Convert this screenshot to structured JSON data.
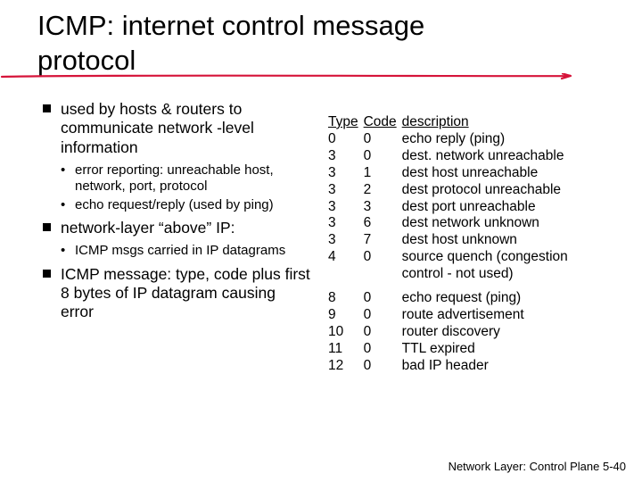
{
  "title_line1": "ICMP: internet control message",
  "title_line2": "protocol",
  "left": {
    "b1": "used by hosts & routers to communicate network -level information",
    "b1_s1": "error reporting: unreachable host, network, port, protocol",
    "b1_s2": "echo request/reply (used by ping)",
    "b2": "network-layer “above” IP:",
    "b2_s1": "ICMP msgs carried in IP datagrams",
    "b3": "ICMP message: type, code plus first 8 bytes of IP datagram causing error"
  },
  "table": {
    "h_type": "Type",
    "h_code": "Code",
    "h_desc": "description",
    "rows_a": [
      {
        "t": "0",
        "c": "0",
        "d": "echo reply (ping)"
      },
      {
        "t": "3",
        "c": "0",
        "d": "dest. network unreachable"
      },
      {
        "t": "3",
        "c": "1",
        "d": "dest host unreachable"
      },
      {
        "t": "3",
        "c": "2",
        "d": "dest protocol unreachable"
      },
      {
        "t": "3",
        "c": "3",
        "d": "dest port unreachable"
      },
      {
        "t": "3",
        "c": "6",
        "d": "dest network unknown"
      },
      {
        "t": "3",
        "c": "7",
        "d": "dest host unknown"
      },
      {
        "t": "4",
        "c": "0",
        "d": "source quench (congestion control - not used)"
      }
    ],
    "rows_b": [
      {
        "t": "8",
        "c": "0",
        "d": "echo request (ping)"
      },
      {
        "t": "9",
        "c": "0",
        "d": "route advertisement"
      },
      {
        "t": "10",
        "c": "0",
        "d": "router discovery"
      },
      {
        "t": "11",
        "c": "0",
        "d": "TTL expired"
      },
      {
        "t": "12",
        "c": "0",
        "d": "bad IP header"
      }
    ]
  },
  "footer": "Network Layer: Control Plane  5-40",
  "chart_data": {
    "type": "table",
    "title": "ICMP type/code/description",
    "columns": [
      "Type",
      "Code",
      "description"
    ],
    "rows": [
      [
        "0",
        "0",
        "echo reply (ping)"
      ],
      [
        "3",
        "0",
        "dest. network unreachable"
      ],
      [
        "3",
        "1",
        "dest host unreachable"
      ],
      [
        "3",
        "2",
        "dest protocol unreachable"
      ],
      [
        "3",
        "3",
        "dest port unreachable"
      ],
      [
        "3",
        "6",
        "dest network unknown"
      ],
      [
        "3",
        "7",
        "dest host unknown"
      ],
      [
        "4",
        "0",
        "source quench (congestion control - not used)"
      ],
      [
        "8",
        "0",
        "echo request (ping)"
      ],
      [
        "9",
        "0",
        "route advertisement"
      ],
      [
        "10",
        "0",
        "router discovery"
      ],
      [
        "11",
        "0",
        "TTL expired"
      ],
      [
        "12",
        "0",
        "bad IP header"
      ]
    ]
  }
}
